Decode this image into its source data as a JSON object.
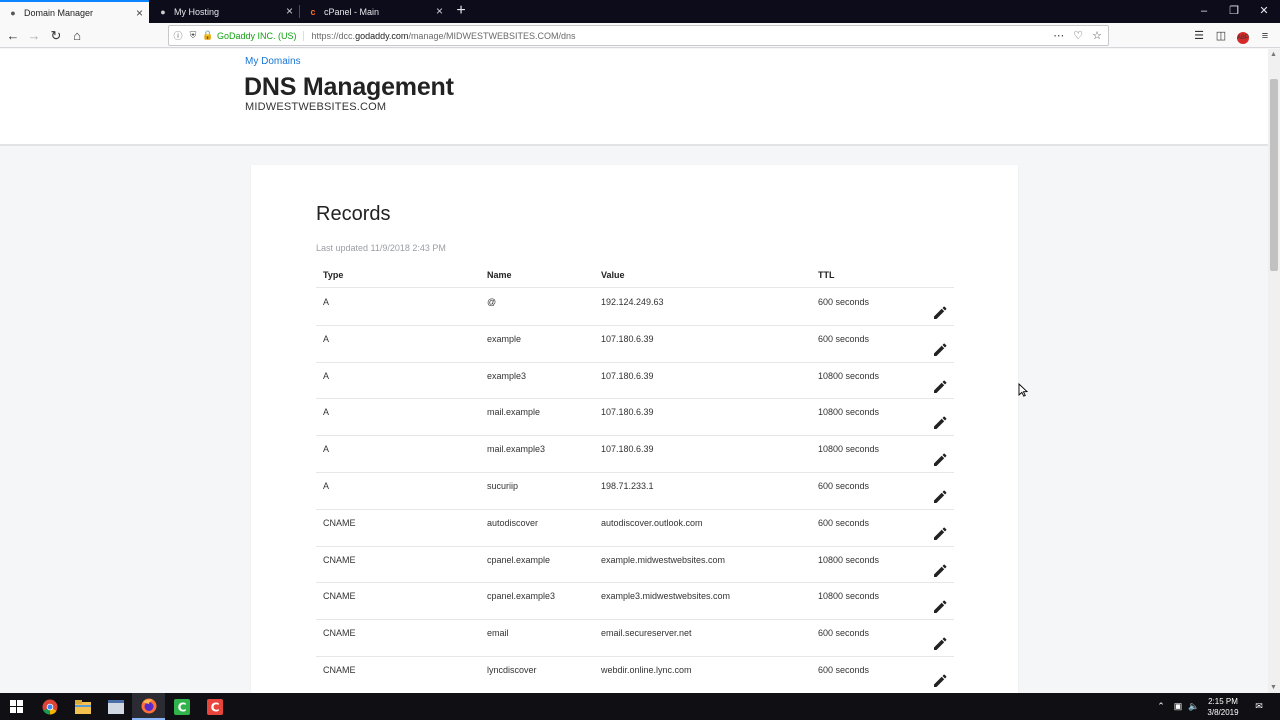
{
  "browser": {
    "tabs": [
      {
        "label": "Domain Manager",
        "active": true
      },
      {
        "label": "My Hosting",
        "active": false
      },
      {
        "label": "cPanel - Main",
        "active": false
      }
    ],
    "identity": "GoDaddy INC. (US)",
    "url_prefix": "https://dcc.",
    "url_domain": "godaddy.com",
    "url_path": "/manage/MIDWESTWEBSITES.COM/dns"
  },
  "page": {
    "breadcrumb": "My Domains",
    "title": "DNS Management",
    "domain": "MIDWESTWEBSITES.COM"
  },
  "records": {
    "title": "Records",
    "last_updated": "Last updated 11/9/2018 2:43 PM",
    "columns": {
      "type": "Type",
      "name": "Name",
      "value": "Value",
      "ttl": "TTL"
    },
    "rows": [
      {
        "type": "A",
        "name": "@",
        "value": "192.124.249.63",
        "ttl": "600 seconds"
      },
      {
        "type": "A",
        "name": "example",
        "value": "107.180.6.39",
        "ttl": "600 seconds"
      },
      {
        "type": "A",
        "name": "example3",
        "value": "107.180.6.39",
        "ttl": "10800 seconds"
      },
      {
        "type": "A",
        "name": "mail.example",
        "value": "107.180.6.39",
        "ttl": "10800 seconds"
      },
      {
        "type": "A",
        "name": "mail.example3",
        "value": "107.180.6.39",
        "ttl": "10800 seconds"
      },
      {
        "type": "A",
        "name": "sucuriip",
        "value": "198.71.233.1",
        "ttl": "600 seconds"
      },
      {
        "type": "CNAME",
        "name": "autodiscover",
        "value": "autodiscover.outlook.com",
        "ttl": "600 seconds"
      },
      {
        "type": "CNAME",
        "name": "cpanel.example",
        "value": "example.midwestwebsites.com",
        "ttl": "10800 seconds"
      },
      {
        "type": "CNAME",
        "name": "cpanel.example3",
        "value": "example3.midwestwebsites.com",
        "ttl": "10800 seconds"
      },
      {
        "type": "CNAME",
        "name": "email",
        "value": "email.secureserver.net",
        "ttl": "600 seconds"
      },
      {
        "type": "CNAME",
        "name": "lyncdiscover",
        "value": "webdir.online.lync.com",
        "ttl": "600 seconds"
      }
    ]
  },
  "taskbar": {
    "time": "2:15 PM",
    "date": "3/8/2019"
  },
  "colors": {
    "accent_link": "#1976d2",
    "tab_active_indicator": "#0a84ff",
    "secure_green": "#12a012"
  }
}
